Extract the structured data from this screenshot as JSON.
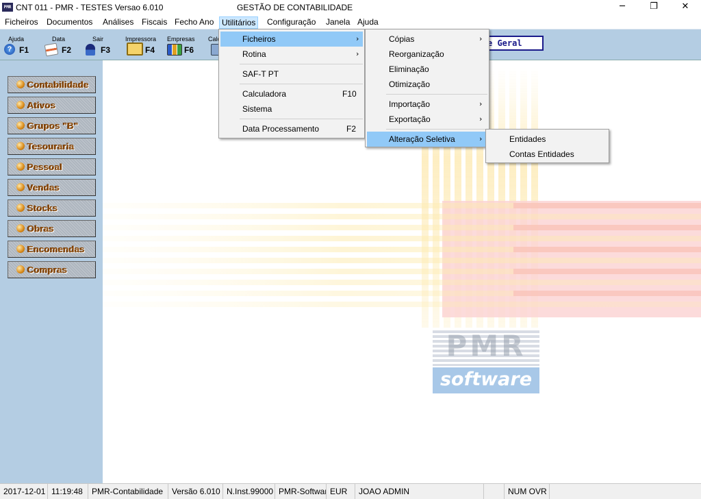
{
  "window": {
    "title": "CNT 011 - PMR - TESTES Versao 6.010",
    "center_title": "GESTÃO DE CONTABILIDADE",
    "minimize": "─",
    "maximize": "❐",
    "close": "✕"
  },
  "menubar": [
    "Ficheiros",
    "Documentos",
    "Análises",
    "Fiscais",
    "Fecho Ano",
    "Utilitários",
    "Configuração",
    "Janela",
    "Ajuda"
  ],
  "toolbar": {
    "items": [
      {
        "caption": "Ajuda",
        "key": "F1"
      },
      {
        "caption": "Data",
        "key": "F2"
      },
      {
        "caption": "Sair",
        "key": "F3"
      },
      {
        "caption": "Impressora",
        "key": "F4"
      },
      {
        "caption": "Empresas",
        "key": "F6"
      },
      {
        "caption": "Calc",
        "key": ""
      }
    ],
    "field_text": "e Geral"
  },
  "modules": [
    "Contabilidade",
    "Ativos",
    "Grupos \"B\"",
    "Tesouraria",
    "Pessoal",
    "Vendas",
    "Stocks",
    "Obras",
    "Encomendas",
    "Compras"
  ],
  "logo": {
    "pmr": "PMR",
    "software": "software"
  },
  "utilitarios_menu": {
    "items": [
      {
        "label": "Ficheiros",
        "shortcut": "",
        "submenu": true
      },
      {
        "label": "Rotina",
        "shortcut": "",
        "submenu": true
      },
      {
        "label": "SAF-T PT",
        "shortcut": "",
        "submenu": false
      },
      {
        "label": "Calculadora",
        "shortcut": "F10",
        "submenu": false
      },
      {
        "label": "Sistema",
        "shortcut": "",
        "submenu": false
      },
      {
        "label": "Data Processamento",
        "shortcut": "F2",
        "submenu": false
      }
    ]
  },
  "ficheiros_submenu": {
    "items": [
      {
        "label": "Cópias",
        "submenu": true
      },
      {
        "label": "Reorganização",
        "submenu": false
      },
      {
        "label": "Eliminação",
        "submenu": false
      },
      {
        "label": "Otimização",
        "submenu": false
      },
      {
        "label": "Importação",
        "submenu": true
      },
      {
        "label": "Exportação",
        "submenu": true
      },
      {
        "label": "Alteração Seletiva",
        "submenu": true
      }
    ]
  },
  "alteracao_submenu": {
    "items": [
      "Entidades",
      "Contas Entidades"
    ]
  },
  "status": {
    "date": "2017-12-01",
    "time": "11:19:48",
    "app": "PMR-Contabilidade",
    "version": "Versão  6.010",
    "inst": "N.Inst.99000",
    "vendor": "PMR-Software",
    "currency": "EUR",
    "user": "JOAO ADMIN",
    "keys": "NUM OVR"
  },
  "colors": {
    "accent_highlight": "#91c9f7",
    "panel_blue": "#b4cde3",
    "module_text": "#8a4a0a"
  }
}
